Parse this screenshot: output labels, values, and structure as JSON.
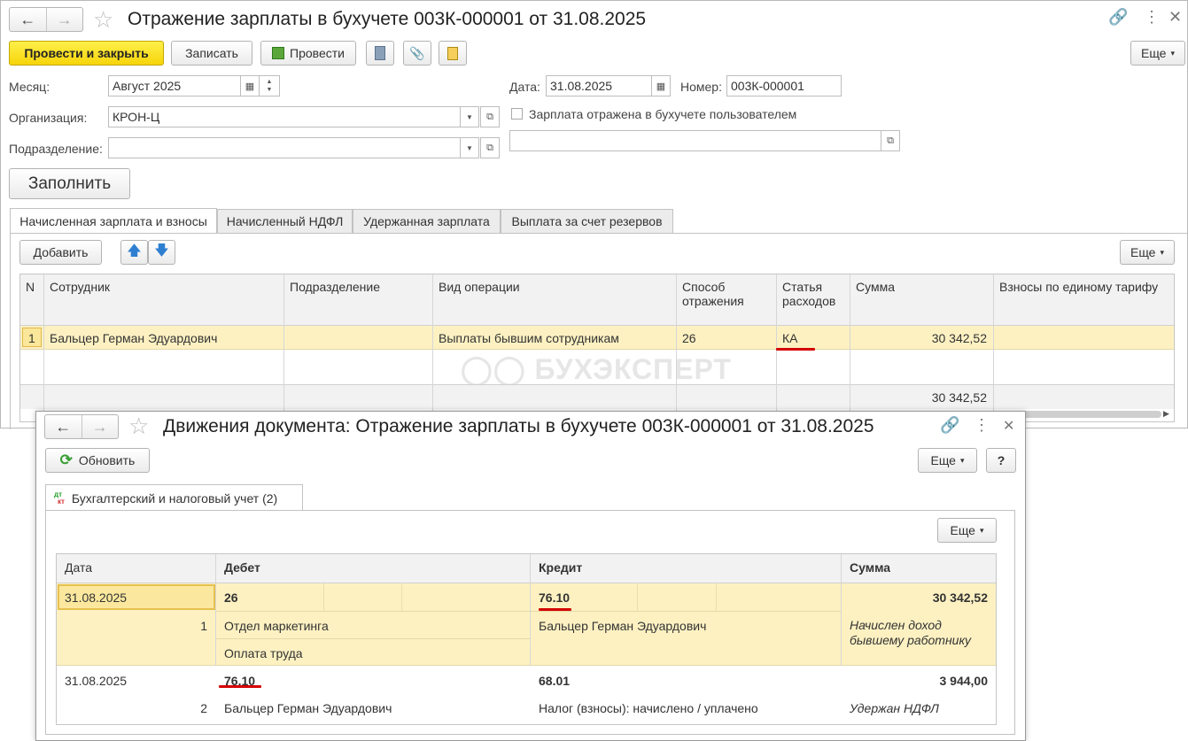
{
  "main_window": {
    "title": "Отражение зарплаты в бухучете 003К-000001 от 31.08.2025",
    "toolbar": {
      "post_close": "Провести и закрыть",
      "save": "Записать",
      "post": "Провести",
      "more": "Еще"
    },
    "form": {
      "month_label": "Месяц:",
      "month_value": "Август 2025",
      "date_label": "Дата:",
      "date_value": "31.08.2025",
      "number_label": "Номер:",
      "number_value": "003К-000001",
      "org_label": "Организация:",
      "org_value": "КРОН-Ц",
      "dept_label": "Подразделение:",
      "dept_value": "",
      "checkbox_label": "Зарплата отражена в бухучете пользователем",
      "checkbox_checked": false,
      "fill_button": "Заполнить"
    },
    "tabs": [
      {
        "label": "Начисленная зарплата и взносы",
        "active": true
      },
      {
        "label": "Начисленный НДФЛ",
        "active": false
      },
      {
        "label": "Удержанная зарплата",
        "active": false
      },
      {
        "label": "Выплата за счет резервов",
        "active": false
      }
    ],
    "table_toolbar": {
      "add": "Добавить",
      "more": "Еще"
    },
    "table": {
      "headers": {
        "n": "N",
        "employee": "Сотрудник",
        "dept": "Подразделение",
        "operation": "Вид операции",
        "method": "Способ отражения",
        "expense": "Статья расходов",
        "sum": "Сумма",
        "contrib": "Взносы по единому тарифу"
      },
      "rows": [
        {
          "n": "1",
          "employee": "Бальцер Герман Эдуардович",
          "dept": "",
          "operation": "Выплаты бывшим сотрудникам",
          "method": "26",
          "expense": "КА",
          "sum": "30 342,52",
          "contrib": ""
        }
      ],
      "total_sum": "30 342,52"
    },
    "watermark": "БУХЭКСПЕРТ"
  },
  "movements_window": {
    "title": "Движения документа: Отражение зарплаты в бухучете 003К-000001 от 31.08.2025",
    "refresh": "Обновить",
    "more": "Еще",
    "help": "?",
    "tab_icon_top": "дт",
    "tab_icon_bottom": "кт",
    "tab_label": "Бухгалтерский и налоговый учет (2)",
    "inner_more": "Еще",
    "headers": {
      "date": "Дата",
      "debit": "Дебет",
      "credit": "Кредит",
      "sum": "Сумма"
    },
    "entries": [
      {
        "date": "31.08.2025",
        "num": "1",
        "debit_account": "26",
        "debit_sub1": "Отдел маркетинга",
        "debit_sub2": "Оплата труда",
        "credit_account": "76.10",
        "credit_sub1": "Бальцер Герман Эдуардович",
        "sum": "30 342,52",
        "content": "Начислен доход бывшему работнику"
      },
      {
        "date": "31.08.2025",
        "num": "2",
        "debit_account": "76.10",
        "debit_sub1": "Бальцер Герман Эдуардович",
        "credit_account": "68.01",
        "credit_sub1": "Налог (взносы): начислено / уплачено",
        "sum": "3 944,00",
        "content": "Удержан НДФЛ"
      }
    ]
  },
  "colors": {
    "selected_row": "#fdf1c2",
    "primary_button": "#f6d40a",
    "highlight_underline": "#d40000"
  }
}
